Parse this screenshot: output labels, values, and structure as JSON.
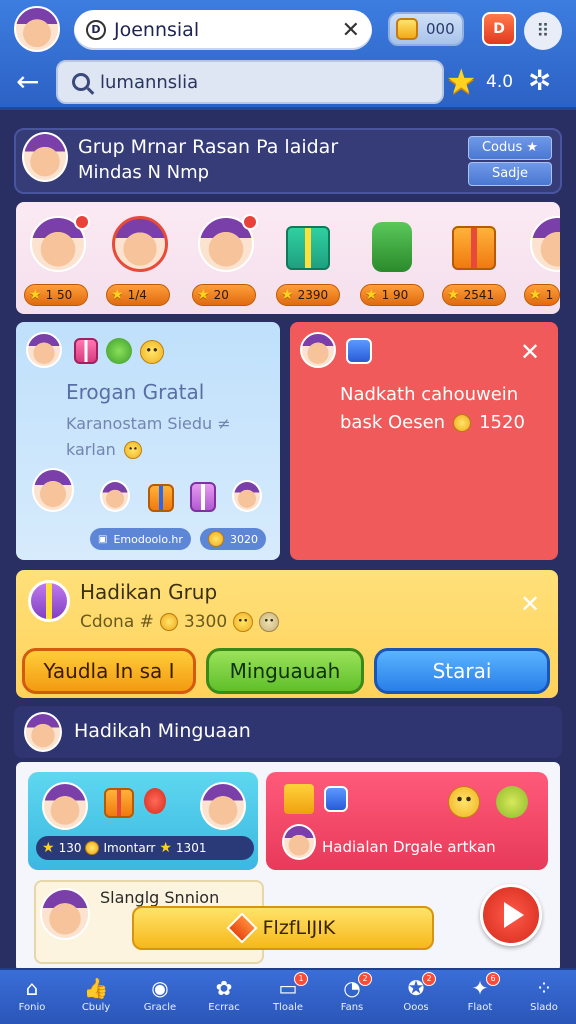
{
  "header": {
    "title": "Joennsial",
    "coins": "000",
    "red_button_label": "D",
    "menu_glyph": "⠿"
  },
  "search": {
    "value": "lumannslia",
    "stars": "4.0"
  },
  "group": {
    "title_line1": "Grup Mrnar Rasan Pa laidar",
    "title_line2": "Mindas N Nmp",
    "btn_top": "Codus ★",
    "btn_bottom": "Sadje"
  },
  "members": [
    {
      "score": "1 50"
    },
    {
      "score": "1/4"
    },
    {
      "score": "20"
    },
    {
      "score": "2390"
    },
    {
      "score": "1 90"
    },
    {
      "score": "2541"
    },
    {
      "score": "1"
    }
  ],
  "blue_card": {
    "title": "Erogan Gratal",
    "sub1": "Karanostam Siedu ≠",
    "sub2": "karlan",
    "pill1": "Emodoolo.hr",
    "pill2": "3020"
  },
  "red_card": {
    "line1": "Nadkath cahouwein",
    "line2": "bask Oesen",
    "value": "1520"
  },
  "yellow_card": {
    "title": "Hadikan Grup",
    "sub": "Cdona #",
    "value": "3300",
    "btn_orange": "Yaudla In sa I",
    "btn_green": "Minguauah",
    "btn_blue": "Starai"
  },
  "section": {
    "title": "Hadikah Minguaan",
    "cyan_pill_a": "130",
    "cyan_pill_b": "Imontarr",
    "cyan_pill_c": "1301",
    "pink_text": "Hadialan Drgale artkan",
    "promo_title": "Slanglg Snnion",
    "flink_label": "FlzfLIJIK"
  },
  "nav": [
    {
      "label": "Fonio",
      "icon": "home-icon",
      "glyph": "⌂",
      "badge": ""
    },
    {
      "label": "Cbuly",
      "icon": "thumb-icon",
      "glyph": "👍",
      "badge": ""
    },
    {
      "label": "Gracle",
      "icon": "shield-icon",
      "glyph": "◉",
      "badge": ""
    },
    {
      "label": "Ecrrac",
      "icon": "pet-icon",
      "glyph": "✿",
      "badge": ""
    },
    {
      "label": "Tloale",
      "icon": "screen-icon",
      "glyph": "▭",
      "badge": "1"
    },
    {
      "label": "Fans",
      "icon": "chat-icon",
      "glyph": "◔",
      "badge": "2"
    },
    {
      "label": "Ooos",
      "icon": "group-icon",
      "glyph": "✪",
      "badge": "2"
    },
    {
      "label": "Flaot",
      "icon": "sparkle-icon",
      "glyph": "✦",
      "badge": "6"
    },
    {
      "label": "Slado",
      "icon": "grid-icon",
      "glyph": "⁘",
      "badge": ""
    }
  ]
}
